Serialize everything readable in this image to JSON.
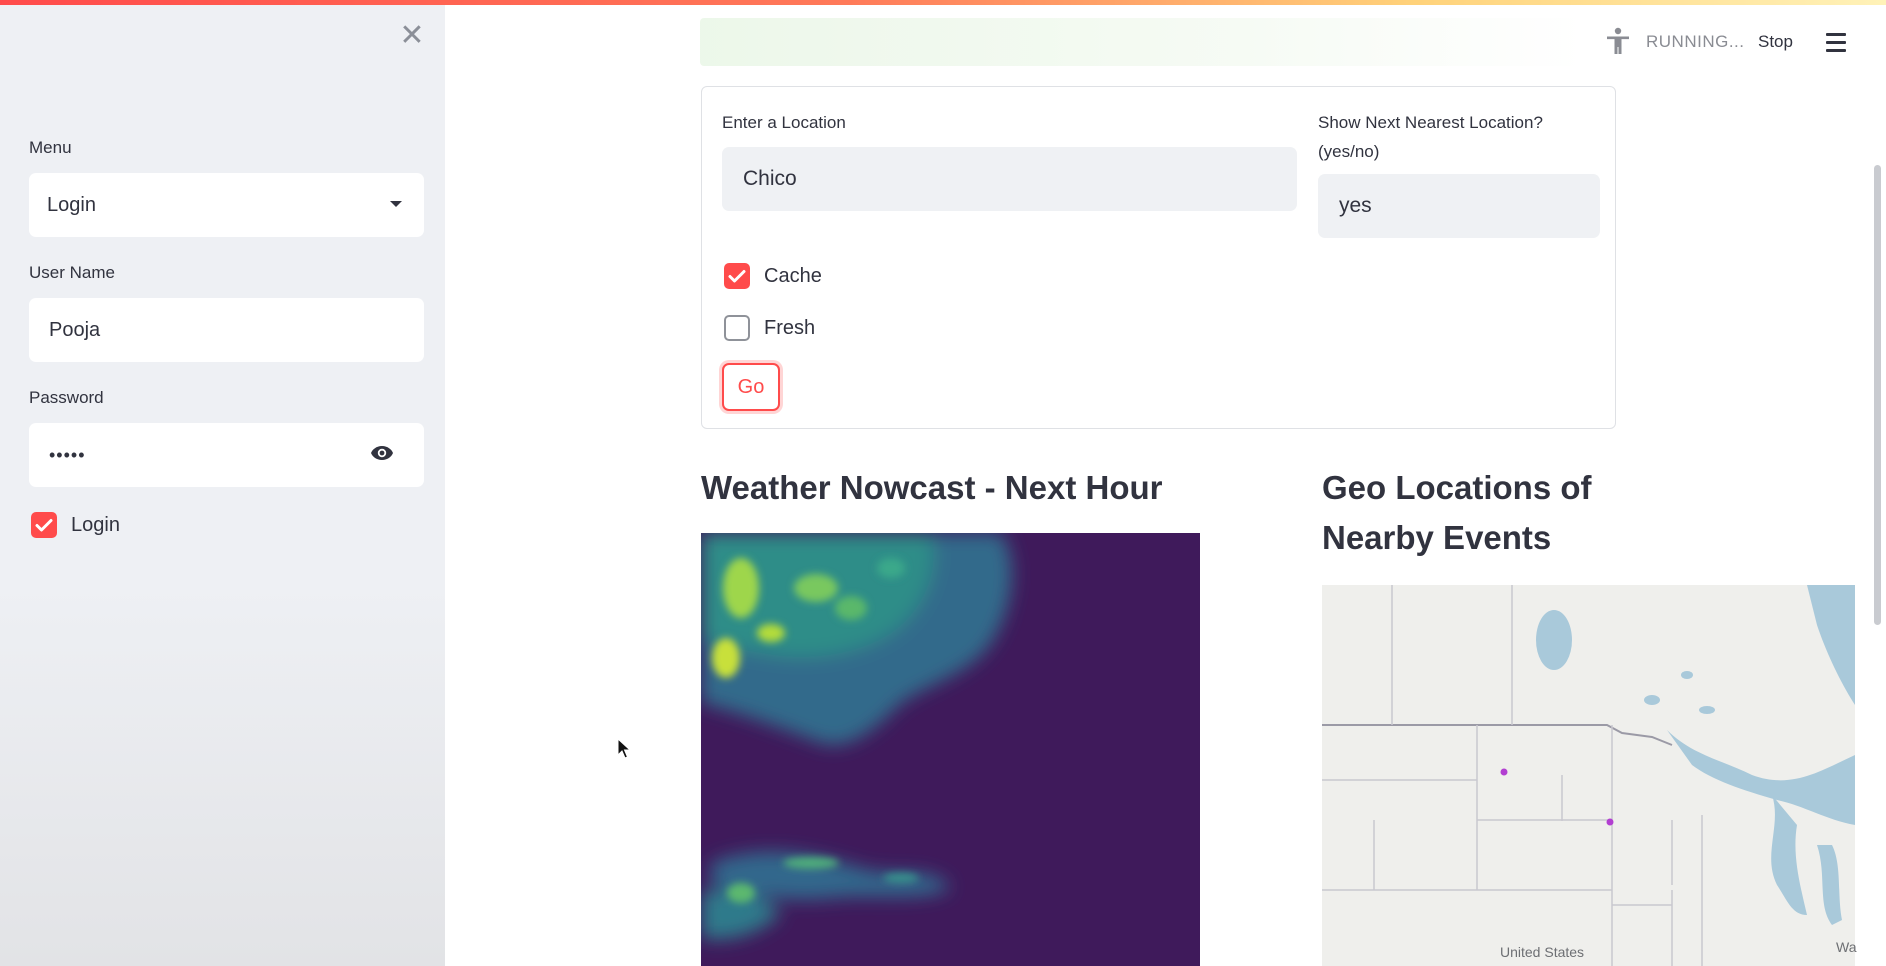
{
  "sidebar": {
    "close_icon": "close-icon",
    "menu_label": "Menu",
    "menu_value": "Login",
    "username_label": "User Name",
    "username_value": "Pooja",
    "password_label": "Password",
    "password_value": "•••••",
    "login_checkbox": {
      "label": "Login",
      "checked": true
    }
  },
  "toolbar": {
    "accessibility_icon": "accessibility-icon",
    "status": "RUNNING...",
    "stop_label": "Stop",
    "menu_icon": "hamburger-menu-icon"
  },
  "form": {
    "location_label": "Enter a Location",
    "location_value": "Chico",
    "next_nearest_label_line1": "Show Next Nearest Location?",
    "next_nearest_label_line2": "(yes/no)",
    "next_nearest_value": "yes",
    "cache": {
      "label": "Cache",
      "checked": true
    },
    "fresh": {
      "label": "Fresh",
      "checked": false
    },
    "go_label": "Go"
  },
  "nowcast": {
    "title": "Weather Nowcast - Next Hour"
  },
  "events_map": {
    "title_line1": "Geo Locations of",
    "title_line2": "Nearby Events",
    "country_label": "United States",
    "edge_label": "Wa"
  },
  "colors": {
    "accent": "#ff4b4b",
    "text": "#31333f",
    "sidebar_bg": "#eef0f4",
    "field_bg": "#eff1f4"
  }
}
